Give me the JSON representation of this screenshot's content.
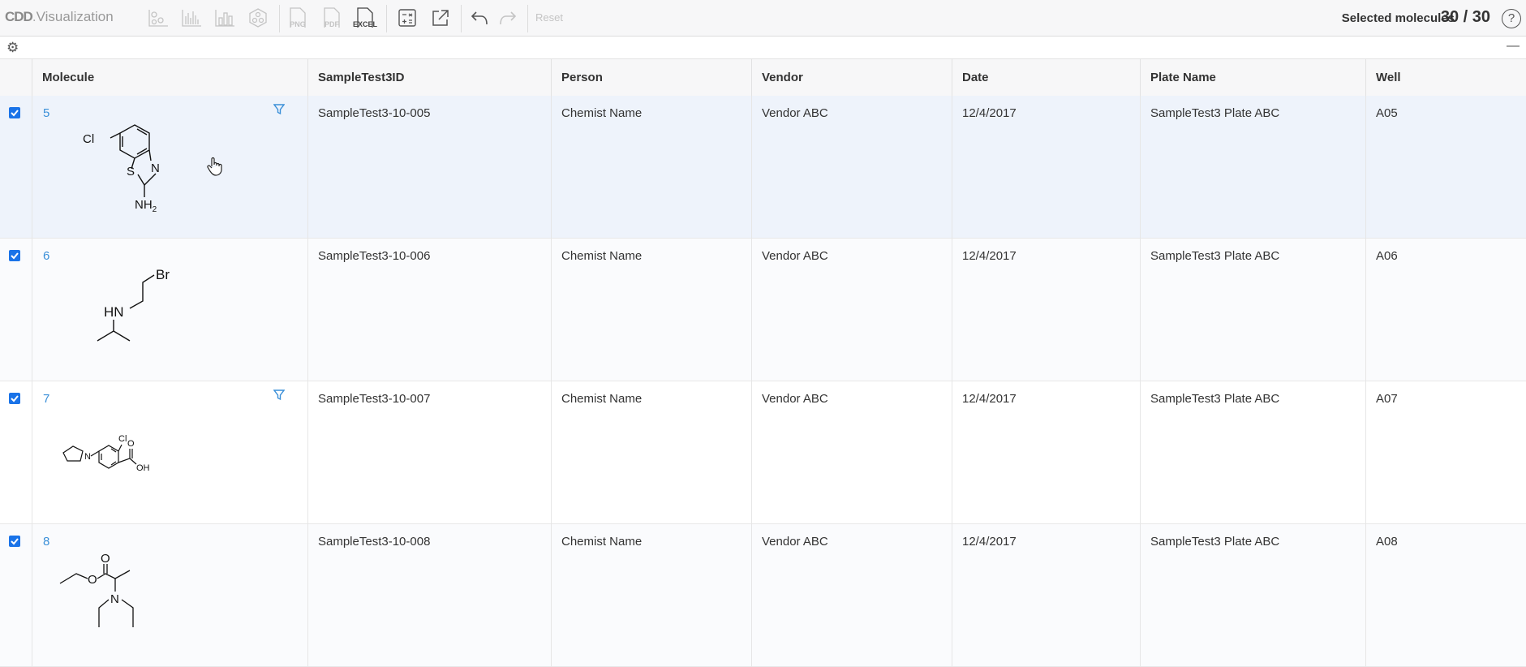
{
  "app": {
    "brand": "CDD",
    "title": "Visualization"
  },
  "toolbar": {
    "export_png": "PNG",
    "export_pdf": "PDF",
    "export_excel": "EXCEL",
    "reset": "Reset",
    "selected_label": "Selected molecules",
    "selected_count": "30 / 30",
    "help": "?"
  },
  "table": {
    "columns": [
      "Molecule",
      "SampleTest3ID",
      "Person",
      "Vendor",
      "Date",
      "Plate Name",
      "Well"
    ],
    "rows": [
      {
        "id": "5",
        "sample_id": "SampleTest3-10-005",
        "person": "Chemist Name",
        "vendor": "Vendor ABC",
        "date": "12/4/2017",
        "plate": "SampleTest3 Plate ABC",
        "well": "A05",
        "checked": true,
        "filter": true,
        "atoms": [
          "Cl",
          "S",
          "N",
          "NH2"
        ]
      },
      {
        "id": "6",
        "sample_id": "SampleTest3-10-006",
        "person": "Chemist Name",
        "vendor": "Vendor ABC",
        "date": "12/4/2017",
        "plate": "SampleTest3 Plate ABC",
        "well": "A06",
        "checked": true,
        "filter": false,
        "atoms": [
          "Br",
          "HN"
        ]
      },
      {
        "id": "7",
        "sample_id": "SampleTest3-10-007",
        "person": "Chemist Name",
        "vendor": "Vendor ABC",
        "date": "12/4/2017",
        "plate": "SampleTest3 Plate ABC",
        "well": "A07",
        "checked": true,
        "filter": true,
        "atoms": [
          "Cl",
          "N",
          "O",
          "OH"
        ]
      },
      {
        "id": "8",
        "sample_id": "SampleTest3-10-008",
        "person": "Chemist Name",
        "vendor": "Vendor ABC",
        "date": "12/4/2017",
        "plate": "SampleTest3 Plate ABC",
        "well": "A08",
        "checked": true,
        "filter": false,
        "atoms": [
          "O",
          "O",
          "N"
        ]
      }
    ]
  },
  "colors": {
    "accent": "#1a73e8",
    "link": "#3a8fd8",
    "highlight_row": "#eef3fb"
  }
}
